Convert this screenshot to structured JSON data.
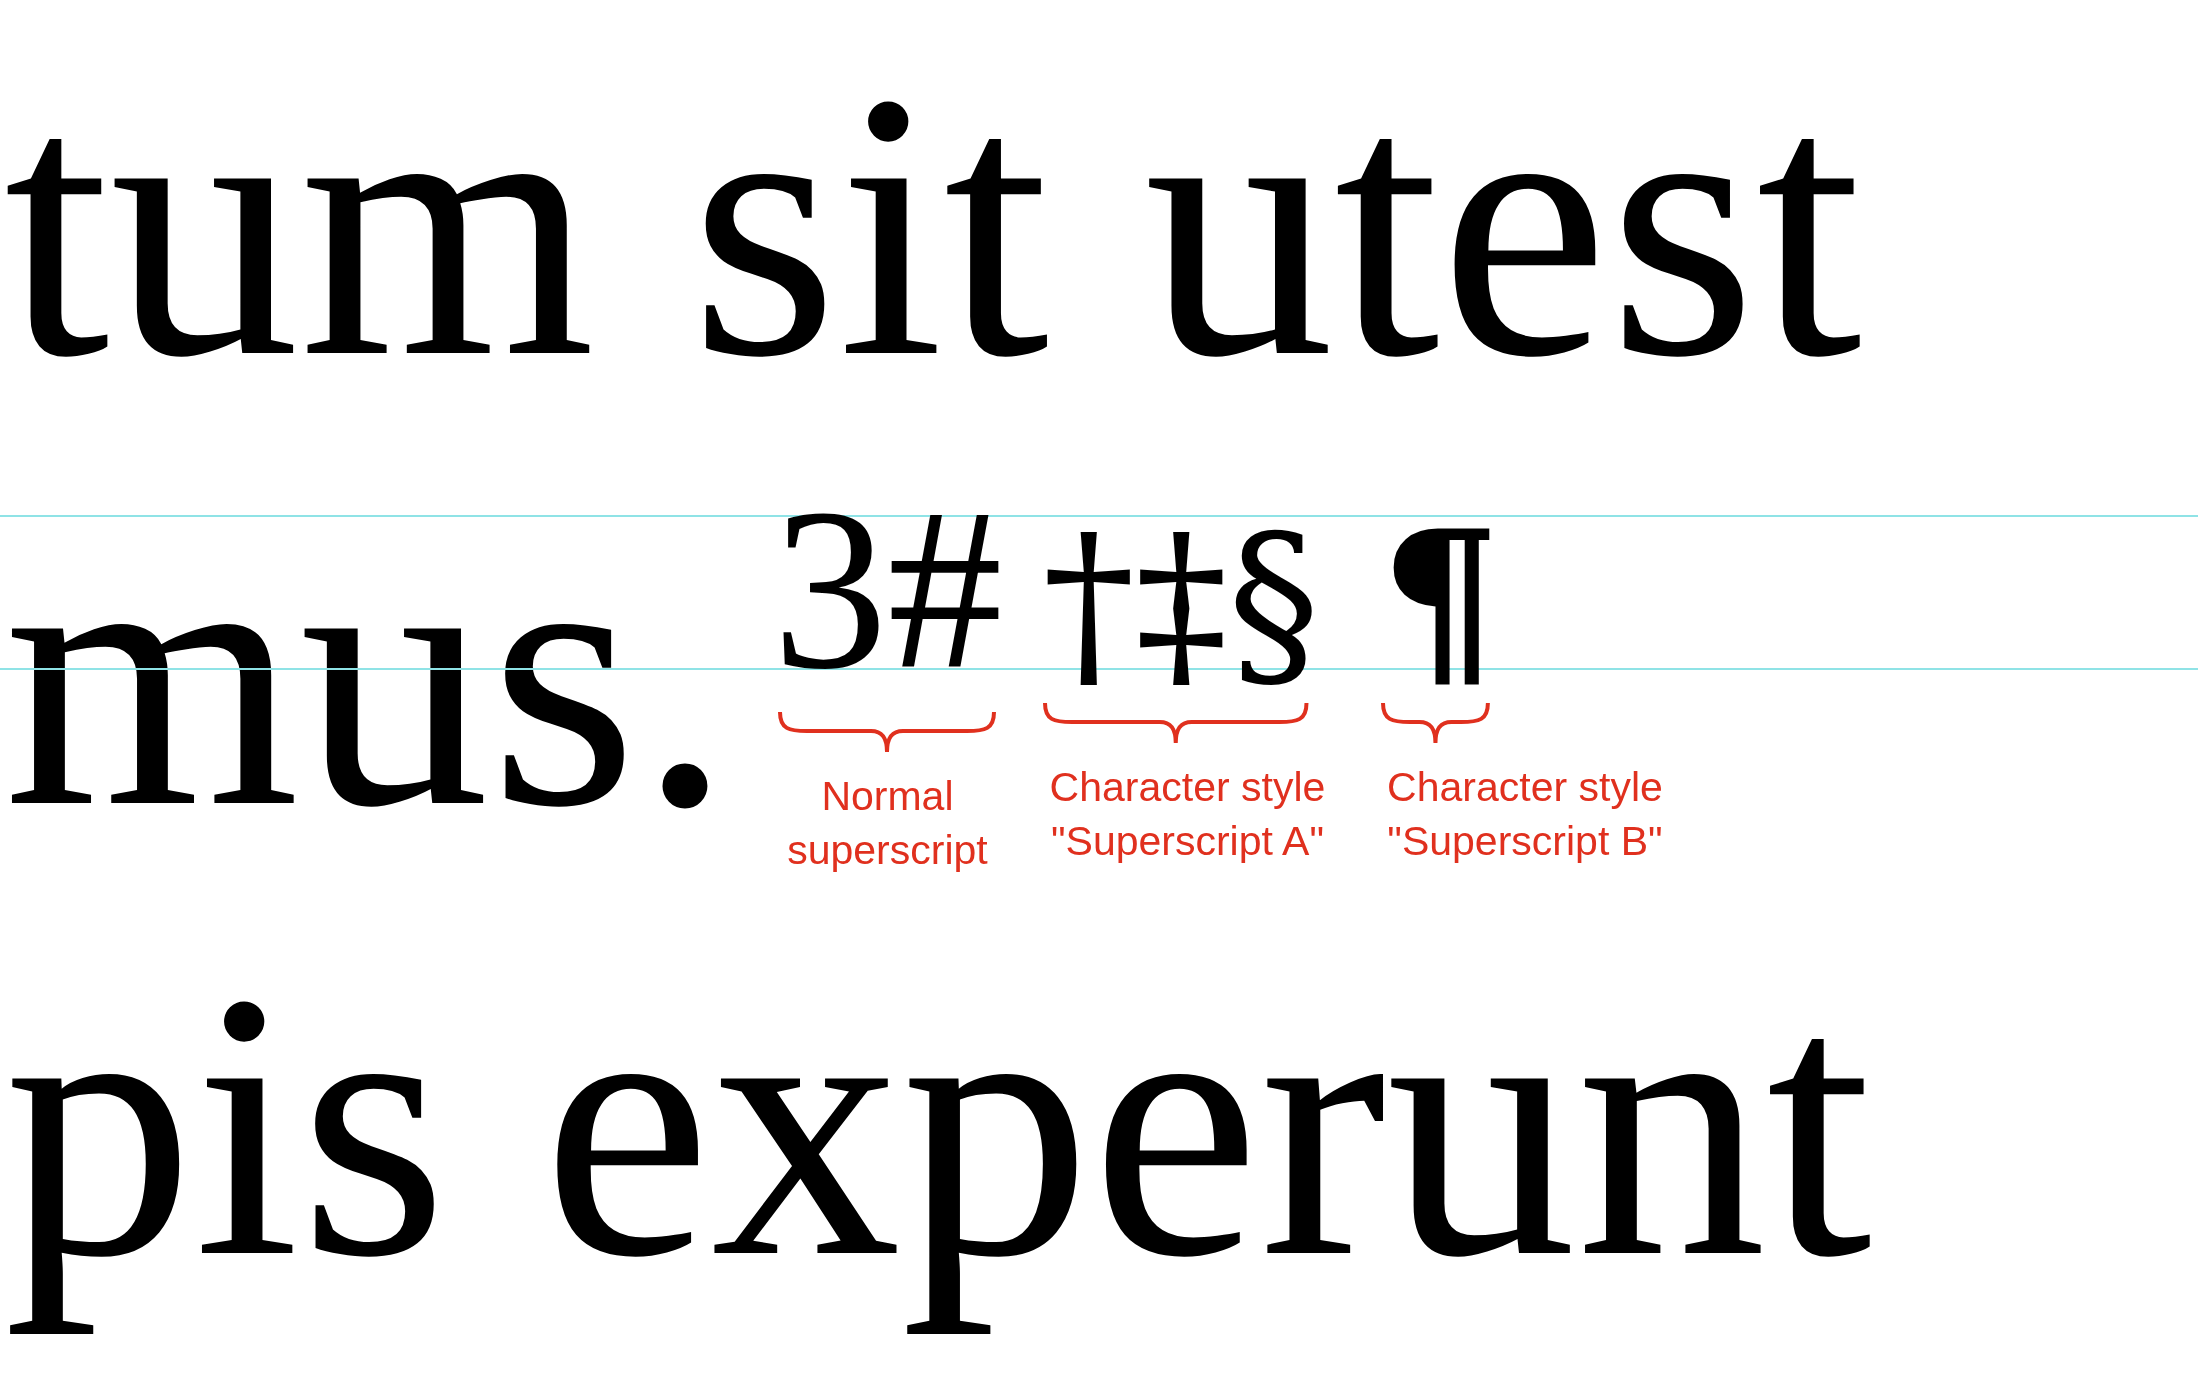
{
  "document": {
    "lines": [
      {
        "text": "tum sit utest"
      },
      {
        "text": "mus.",
        "superscripts": [
          {
            "kind": "normal",
            "text": "3#",
            "annotation": "Normal superscript"
          },
          {
            "kind": "style_a",
            "text": "†‡§",
            "annotation": "Character style \"Superscript A\""
          },
          {
            "kind": "style_b",
            "text": "¶",
            "annotation": "Character style \"Superscript B\""
          }
        ]
      },
      {
        "text": "pis experunt"
      }
    ]
  }
}
